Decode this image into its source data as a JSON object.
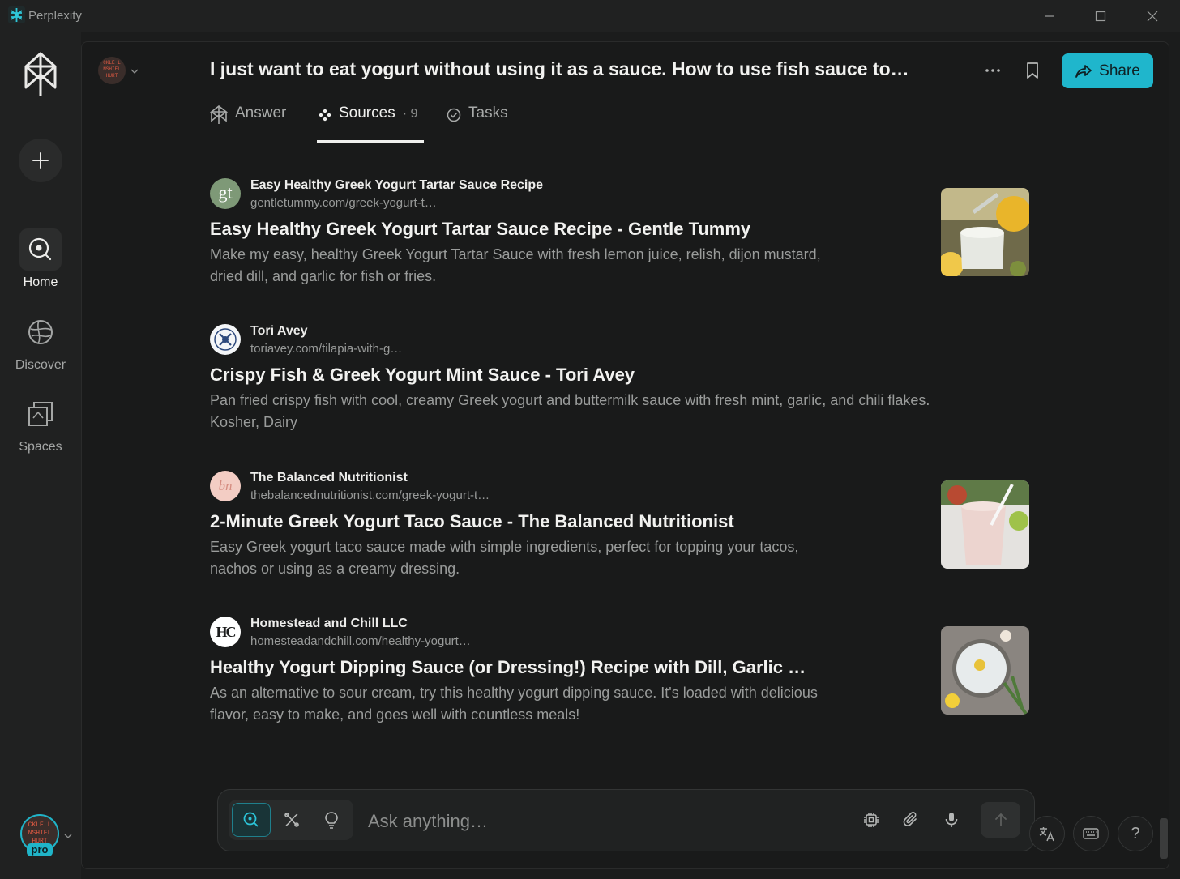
{
  "window": {
    "title": "Perplexity"
  },
  "sidebar": {
    "items": [
      {
        "label": "Home"
      },
      {
        "label": "Discover"
      },
      {
        "label": "Spaces"
      }
    ],
    "pro_badge": "pro",
    "avatar_text": "CKLE L NSHIEL HURT"
  },
  "header": {
    "title": "I just want to eat yogurt without using it as a sauce. How to use fish sauce to…",
    "share_label": "Share"
  },
  "tabs": [
    {
      "label": "Answer"
    },
    {
      "label": "Sources",
      "count": "· 9"
    },
    {
      "label": "Tasks"
    }
  ],
  "sources": [
    {
      "site_name": "Easy Healthy Greek Yogurt Tartar Sauce Recipe",
      "url": "gentletummy.com/greek-yogurt-t…",
      "title": "Easy Healthy Greek Yogurt Tartar Sauce Recipe - Gentle Tummy",
      "snippet_lines": [
        "Make my easy, healthy Greek Yogurt Tartar Sauce with fresh lemon juice, relish, dijon mustard,",
        "dried dill, and garlic for fish or fries."
      ],
      "favicon_text": "gt"
    },
    {
      "site_name": "Tori Avey",
      "url": "toriavey.com/tilapia-with-g…",
      "title": "Crispy Fish & Greek Yogurt Mint Sauce - Tori Avey",
      "snippet_lines": [
        "Pan fried crispy fish with cool, creamy Greek yogurt and buttermilk sauce with fresh mint, garlic, and chili flakes.",
        "Kosher, Dairy"
      ]
    },
    {
      "site_name": "The Balanced Nutritionist",
      "url": "thebalancednutritionist.com/greek-yogurt-t…",
      "title": "2-Minute Greek Yogurt Taco Sauce - The Balanced Nutritionist",
      "snippet_lines": [
        "Easy Greek yogurt taco sauce made with simple ingredients, perfect for topping your tacos,",
        "nachos or using as a creamy dressing."
      ],
      "favicon_text": "bn"
    },
    {
      "site_name": "Homestead and Chill LLC",
      "url": "homesteadandchill.com/healthy-yogurt…",
      "title": "Healthy Yogurt Dipping Sauce (or Dressing!) Recipe with Dill, Garlic …",
      "snippet_lines": [
        "As an alternative to sour cream, try this healthy yogurt dipping sauce. It's loaded with delicious",
        "flavor, easy to make, and goes well with countless meals!"
      ],
      "favicon_text": "HC"
    }
  ],
  "composer": {
    "placeholder": "Ask anything…",
    "help_label": "?"
  },
  "icons": {
    "search": "search-icon",
    "research": "research-icon",
    "lightbulb": "lightbulb-icon",
    "chip": "chip-icon",
    "attach": "paperclip-icon",
    "mic": "microphone-icon",
    "send": "arrow-up-icon",
    "translate": "translate-icon",
    "keyboard": "keyboard-icon"
  },
  "colors": {
    "accent": "#1fb6cc",
    "background": "#191a1a",
    "sidebar": "#202121"
  }
}
